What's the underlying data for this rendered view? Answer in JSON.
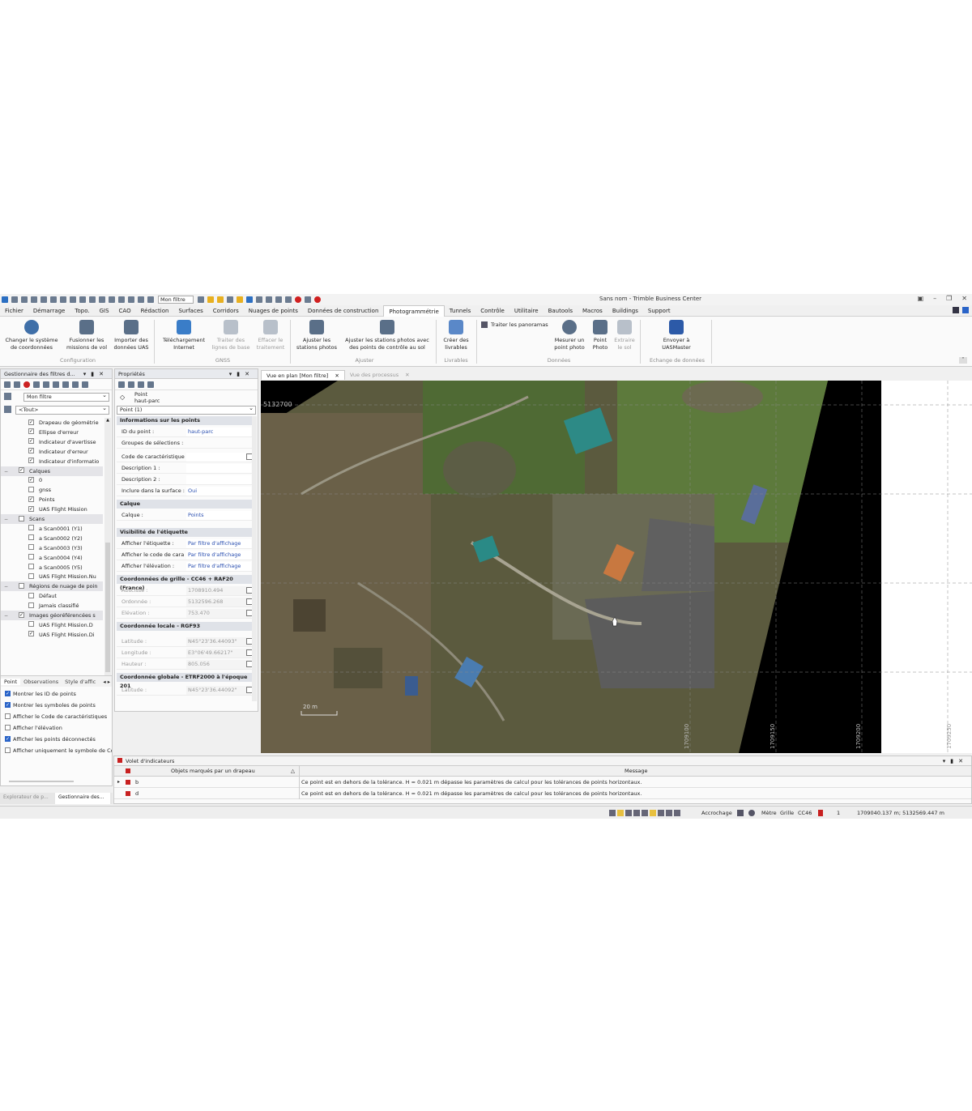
{
  "app": {
    "title": "Sans nom - Trimble Business Center",
    "filter_value": "Mon filtre"
  },
  "menu": {
    "items": [
      "Fichier",
      "Démarrage",
      "Topo.",
      "GIS",
      "CAO",
      "Rédaction",
      "Surfaces",
      "Corridors",
      "Nuages de points",
      "Données de construction",
      "Photogrammétrie",
      "Tunnels",
      "Contrôle",
      "Utilitaire",
      "Bautools",
      "Macros",
      "Buildings",
      "Support"
    ],
    "active": "Photogrammétrie"
  },
  "ribbon": {
    "btn_change_system": "Changer le système\nde coordonnées",
    "btn_merge": "Fusionner les\nmissions de vol",
    "btn_import_uas": "Importer des\ndonnées UAS",
    "grp_config": "Configuration",
    "btn_download": "Téléchargement\nInternet",
    "btn_process_base": "Traiter des\nlignes de base",
    "btn_clear": "Effacer le\ntraitement",
    "grp_gnss": "GNSS",
    "btn_adjust_stations": "Ajuster les\nstations photos",
    "btn_adjust_control": "Ajuster les stations photos avec\ndes points de contrôle au sol",
    "grp_adjust": "Ajuster",
    "btn_deliverables": "Créer des\nlivrables",
    "grp_deliverables": "Livrables",
    "btn_panoramas": "Traiter les panoramas",
    "btn_measure": "Mesurer un\npoint photo",
    "btn_point_photo": "Point\nPhoto",
    "btn_extract": "Extraire\nle sol",
    "grp_data": "Données",
    "btn_send": "Envoyer à\nUASMaster",
    "grp_exchange": "Echange de données"
  },
  "filter_panel": {
    "title": "Gestionnaire des filtres d...",
    "filter_combo": "Mon filtre",
    "all_combo": "<Tout>",
    "rows": [
      {
        "label": "Drapeau de géométrie",
        "checked": true,
        "indent": 2
      },
      {
        "label": "Ellipse d'erreur",
        "checked": true,
        "indent": 2
      },
      {
        "label": "Indicateur d'avertisse",
        "checked": true,
        "indent": 2
      },
      {
        "label": "Indicateur d'erreur",
        "checked": true,
        "indent": 2
      },
      {
        "label": "Indicateur d'informatio",
        "checked": true,
        "indent": 2
      },
      {
        "label": "Calques",
        "checked": true,
        "indent": 1,
        "header": true
      },
      {
        "label": "0",
        "checked": true,
        "indent": 2
      },
      {
        "label": "gnss",
        "checked": false,
        "indent": 2
      },
      {
        "label": "Points",
        "checked": true,
        "indent": 2
      },
      {
        "label": "UAS Flight Mission",
        "checked": true,
        "indent": 2
      },
      {
        "label": "Scans",
        "checked": false,
        "indent": 1,
        "header": true
      },
      {
        "label": "a Scan0001 (Y1)",
        "checked": false,
        "indent": 2
      },
      {
        "label": "a Scan0002 (Y2)",
        "checked": false,
        "indent": 2
      },
      {
        "label": "a Scan0003 (Y3)",
        "checked": false,
        "indent": 2
      },
      {
        "label": "a Scan0004 (Y4)",
        "checked": false,
        "indent": 2
      },
      {
        "label": "a Scan0005 (Y5)",
        "checked": false,
        "indent": 2
      },
      {
        "label": "UAS Flight Mission.Nu",
        "checked": false,
        "indent": 2
      },
      {
        "label": "Régions de nuage de poin",
        "checked": false,
        "indent": 1,
        "header": true
      },
      {
        "label": "Défaut",
        "checked": false,
        "indent": 2
      },
      {
        "label": "Jamais classifié",
        "checked": false,
        "indent": 2
      },
      {
        "label": "Images géoréférencées s",
        "checked": true,
        "indent": 1,
        "header": true
      },
      {
        "label": "UAS Flight Mission.D",
        "checked": false,
        "indent": 2
      },
      {
        "label": "UAS Flight Mission.Di",
        "checked": true,
        "indent": 2
      }
    ],
    "subtabs": [
      "Point",
      "Observations",
      "Style d'affic"
    ],
    "options": [
      {
        "label": "Montrer les ID de points",
        "checked": true
      },
      {
        "label": "Montrer les symboles de points",
        "checked": true
      },
      {
        "label": "Afficher le Code de caractéristiques",
        "checked": false
      },
      {
        "label": "Afficher l'élévation",
        "checked": false
      },
      {
        "label": "Afficher les points déconnectés",
        "checked": true
      },
      {
        "label": "Afficher uniquement le symbole de Code c",
        "checked": false
      }
    ],
    "bottom_tabs": [
      "Explorateur de p...",
      "Gestionnaire des..."
    ]
  },
  "properties": {
    "title": "Propriétés",
    "point_label": "Point\nhaut-parc",
    "selector": "Point (1)",
    "sections": {
      "info": "Informations sur les points",
      "layer": "Calque",
      "label_vis": "Visibilité de l'étiquette",
      "grid": "Coordonnées de grille - CC46 + RAF20 (France)",
      "local": "Coordonnée locale - RGF93",
      "global": "Coordonnée globale - ETRF2000 à l'époque 201"
    },
    "rows": {
      "id_k": "ID du point :",
      "id_v": "haut-parc",
      "groups_k": "Groupes de sélections :",
      "code_k": "Code de caractéristique",
      "desc1_k": "Description 1 :",
      "desc2_k": "Description 2 :",
      "surface_k": "Inclure dans la surface :",
      "surface_v": "Oui",
      "layer_k": "Calque :",
      "layer_v": "Points",
      "show_label_k": "Afficher l'étiquette :",
      "show_label_v": "Par filtre d'affichage",
      "show_code_k": "Afficher le code de cara",
      "show_code_v": "Par filtre d'affichage",
      "show_elev_k": "Afficher l'élévation :",
      "show_elev_v": "Par filtre d'affichage",
      "east_k": "Abscisse :",
      "east_v": "1708910.494",
      "north_k": "Ordonnée :",
      "north_v": "5132596.268",
      "elev_k": "Elévation :",
      "elev_v": "753.470",
      "lat_k": "Latitude :",
      "lat_v": "N45°23'36.44093\"",
      "lon_k": "Longitude :",
      "lon_v": "E3°06'49.66217\"",
      "height_k": "Hauteur :",
      "height_v": "805.056",
      "glat_k": "Latitude :",
      "glat_v": "N45°23'36.44092\""
    }
  },
  "view": {
    "tab_active": "Vue en plan [Mon filtre]",
    "tab_inactive": "Vue des processus",
    "y_label": "5132700",
    "x_labels": [
      "1709100",
      "1709150",
      "1709200",
      "1709250"
    ],
    "scale": "20 m"
  },
  "indicators": {
    "title": "Volet d'indicateurs",
    "col_objects": "Objets marqués par un drapeau",
    "col_message": "Message",
    "rows": [
      {
        "obj": "b",
        "msg": "Ce point est en dehors de la tolérance. H = 0.021 m dépasse les paramètres de calcul pour les tolérances de points horizontaux."
      },
      {
        "obj": "d",
        "msg": "Ce point est en dehors de la tolérance. H = 0.021 m dépasse les paramètres de calcul pour les tolérances de points horizontaux."
      }
    ]
  },
  "status": {
    "snap": "Accrochage",
    "unit": "Mètre",
    "grid": "Grille",
    "cs": "CC46",
    "count": "1",
    "coords": "1709040.137 m; 5132569.447 m"
  },
  "colors": {
    "accent": "#2a64c8",
    "map_black": "#000000",
    "vegetation": "#5a6a3a"
  }
}
